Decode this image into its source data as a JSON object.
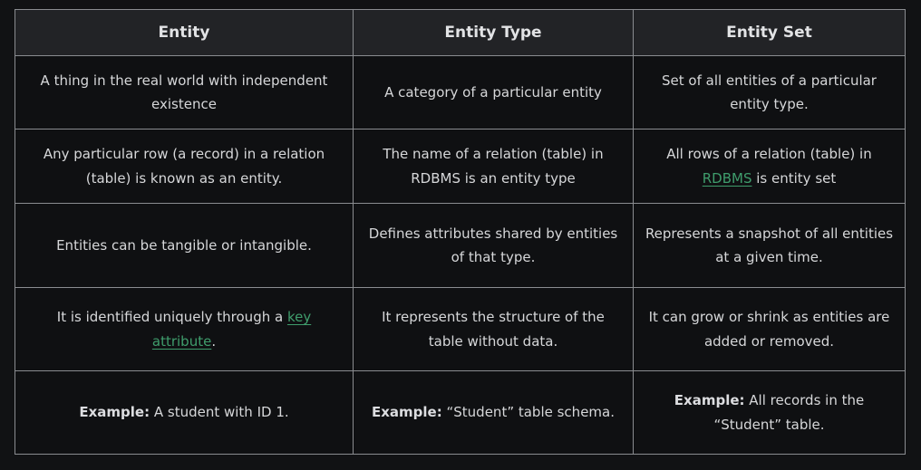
{
  "table": {
    "headers": [
      "Entity",
      "Entity Type",
      "Entity Set"
    ],
    "rows": [
      {
        "entity": "A thing in the real world with independent existence",
        "entity_type": "A category of a particular entity",
        "entity_set": "Set of all entities of a particular entity type."
      },
      {
        "entity": "Any particular row (a record) in a relation (table) is known as an entity.",
        "entity_type": "The name of a relation (table) in RDBMS is an entity type",
        "entity_set_pre": "All rows of a relation (table) in ",
        "entity_set_link": "RDBMS",
        "entity_set_post": " is entity set"
      },
      {
        "entity": "Entities can be tangible or intangible.",
        "entity_type": "Defines attributes shared by entities of that type.",
        "entity_set": "Represents a snapshot of all entities at a given time."
      },
      {
        "entity_pre": "It is identified uniquely through a ",
        "entity_link": "key attribute",
        "entity_post": ".",
        "entity_type": "It represents the structure of the table without data.",
        "entity_set": "It can grow or shrink as entities are added or removed."
      },
      {
        "example_label": "Example:",
        "entity": " A student with ID 1.",
        "entity_type": " “Student” table schema.",
        "entity_set": " All records in the “Student” table."
      }
    ]
  },
  "colors": {
    "background": "#111214",
    "header_bg": "#222326",
    "cell_bg": "#0f1012",
    "border": "#8a8c90",
    "link": "#3f9d6c",
    "text": "#d6d7d9"
  }
}
